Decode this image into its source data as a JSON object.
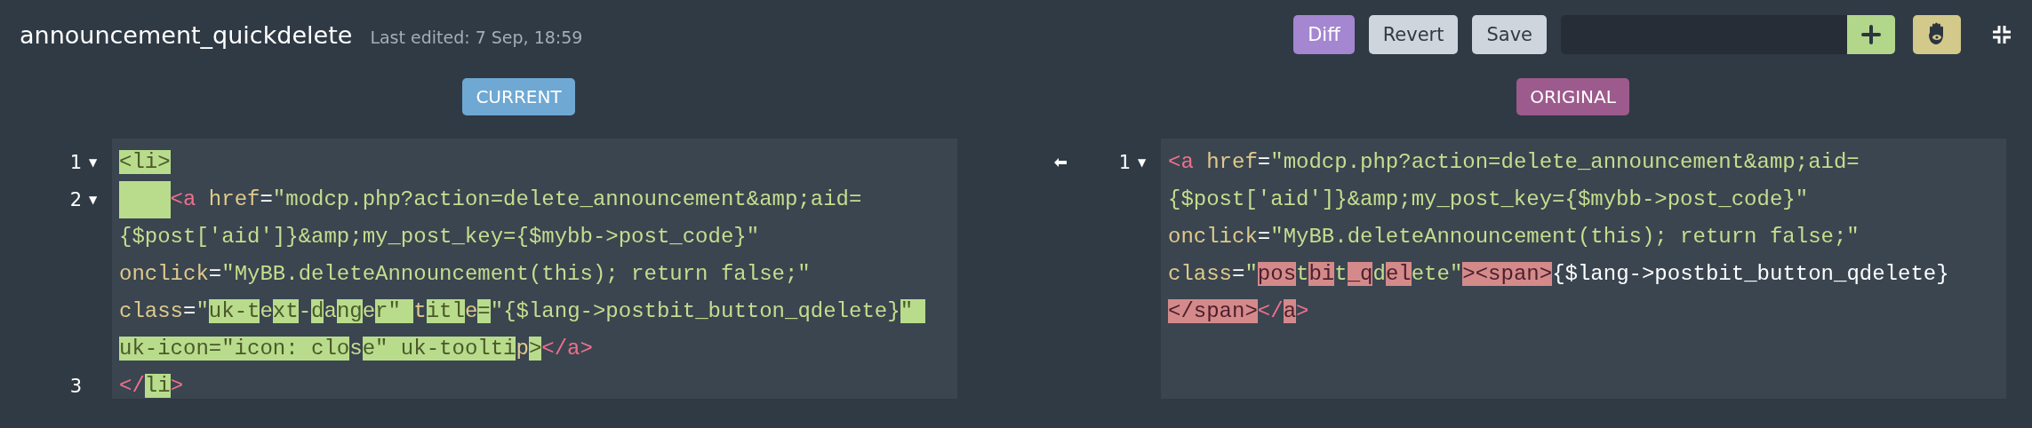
{
  "header": {
    "title": "announcement_quickdelete",
    "last_edited": "Last edited: 7 Sep, 18:59",
    "buttons": [
      {
        "label": "Diff",
        "kind": "diff"
      },
      {
        "label": "Revert",
        "kind": "plain"
      },
      {
        "label": "Save",
        "kind": "plain"
      }
    ]
  },
  "panes": [
    {
      "badge": "CURRENT",
      "kind": "current",
      "rows": [
        {
          "number": "1",
          "fold": "▼",
          "segments": [
            {
              "t": "<li>",
              "kind": "tag",
              "changed": true
            }
          ]
        },
        {
          "number": "2",
          "fold": "▼",
          "segments": [
            {
              "kind": "indent",
              "changed": true
            },
            {
              "t": "<a",
              "kind": "tag",
              "changed": false
            },
            {
              "t": " href",
              "kind": "attr",
              "changed": false
            },
            {
              "t": "=",
              "kind": "plain",
              "changed": false
            },
            {
              "t": "\"modcp.php?action=delete_announcement&amp;aid=",
              "kind": "str",
              "changed": false
            }
          ]
        },
        {
          "segments": [
            {
              "t": "{$post['aid']}&amp;my_post_key={$mybb->post_code}\"",
              "kind": "str",
              "changed": false
            }
          ]
        },
        {
          "segments": [
            {
              "t": "onclick",
              "kind": "attr",
              "changed": false
            },
            {
              "t": "=",
              "kind": "plain",
              "changed": false
            },
            {
              "t": "\"MyBB.deleteAnnouncement(this); return false;\"",
              "kind": "str",
              "changed": false
            }
          ]
        },
        {
          "segments": [
            {
              "t": "class",
              "kind": "attr",
              "changed": false
            },
            {
              "t": "=",
              "kind": "plain",
              "changed": false
            },
            {
              "t": "\"",
              "kind": "str",
              "changed": false
            },
            {
              "t": "uk-t",
              "kind": "str",
              "changed": true
            },
            {
              "t": "e",
              "kind": "str",
              "changed": false
            },
            {
              "t": "xt",
              "kind": "str",
              "changed": true
            },
            {
              "t": "-",
              "kind": "str",
              "changed": false
            },
            {
              "t": "d",
              "kind": "str",
              "changed": true
            },
            {
              "t": "a",
              "kind": "str",
              "changed": false
            },
            {
              "t": "ng",
              "kind": "str",
              "changed": true
            },
            {
              "t": "e",
              "kind": "str",
              "changed": false
            },
            {
              "t": "r\" ",
              "kind": "str",
              "changed": true
            },
            {
              "t": "t",
              "kind": "attr",
              "changed": false
            },
            {
              "t": "itl",
              "kind": "attr",
              "changed": true
            },
            {
              "t": "e",
              "kind": "attr",
              "changed": false
            },
            {
              "t": "=",
              "kind": "plain",
              "changed": true
            },
            {
              "t": "\"{$lang->postbit_button_qdelete}",
              "kind": "str",
              "changed": false
            },
            {
              "t": "\" ",
              "kind": "str",
              "changed": true
            }
          ]
        },
        {
          "segments": [
            {
              "t": "uk-icon=\"icon: clo",
              "kind": "attr",
              "changed": true
            },
            {
              "t": "s",
              "kind": "str",
              "changed": false
            },
            {
              "t": "e\" uk-toolti",
              "kind": "attr",
              "changed": true
            },
            {
              "t": "p",
              "kind": "attr",
              "changed": false
            },
            {
              "t": ">",
              "kind": "tag",
              "changed": true
            },
            {
              "t": "</a>",
              "kind": "tag",
              "changed": false
            }
          ]
        },
        {
          "number": "3",
          "segments": [
            {
              "t": "</",
              "kind": "tag",
              "changed": false
            },
            {
              "t": "li",
              "kind": "tag",
              "changed": true
            },
            {
              "t": ">",
              "kind": "tag",
              "changed": false
            }
          ]
        }
      ]
    },
    {
      "badge": "ORIGINAL",
      "kind": "original",
      "rows": [
        {
          "number": "1",
          "fold": "▼",
          "segments": [
            {
              "t": "<a",
              "kind": "tag",
              "changed": false
            },
            {
              "t": " href",
              "kind": "attr",
              "changed": false
            },
            {
              "t": "=",
              "kind": "plain",
              "changed": false
            },
            {
              "t": "\"modcp.php?action=delete_announcement&amp;aid=",
              "kind": "str",
              "changed": false
            }
          ]
        },
        {
          "segments": [
            {
              "t": "{$post['aid']}&amp;my_post_key={$mybb->post_code}\"",
              "kind": "str",
              "changed": false
            }
          ]
        },
        {
          "segments": [
            {
              "t": "onclick",
              "kind": "attr",
              "changed": false
            },
            {
              "t": "=",
              "kind": "plain",
              "changed": false
            },
            {
              "t": "\"MyBB.deleteAnnouncement(this); return false;\"",
              "kind": "str",
              "changed": false
            }
          ]
        },
        {
          "segments": [
            {
              "t": "class",
              "kind": "attr",
              "changed": false
            },
            {
              "t": "=",
              "kind": "plain",
              "changed": false
            },
            {
              "t": "\"",
              "kind": "str",
              "changed": false
            },
            {
              "t": "pos",
              "kind": "str",
              "changed": true
            },
            {
              "t": "t",
              "kind": "str",
              "changed": false
            },
            {
              "t": "bi",
              "kind": "str",
              "changed": true
            },
            {
              "t": "t",
              "kind": "str",
              "changed": false
            },
            {
              "t": "_q",
              "kind": "str",
              "changed": true
            },
            {
              "t": "d",
              "kind": "str",
              "changed": false
            },
            {
              "t": "el",
              "kind": "str",
              "changed": true
            },
            {
              "t": "ete\"",
              "kind": "str",
              "changed": false
            },
            {
              "t": "><span>",
              "kind": "tag",
              "changed": true
            },
            {
              "t": "{$lang->postbit_button_qdelete}",
              "kind": "plain",
              "changed": false
            }
          ]
        },
        {
          "segments": [
            {
              "t": "</span>",
              "kind": "tag",
              "changed": true
            },
            {
              "t": "</",
              "kind": "tag",
              "changed": false
            },
            {
              "t": "a",
              "kind": "tag",
              "changed": true
            },
            {
              "t": ">",
              "kind": "tag",
              "changed": false
            }
          ]
        }
      ]
    }
  ]
}
